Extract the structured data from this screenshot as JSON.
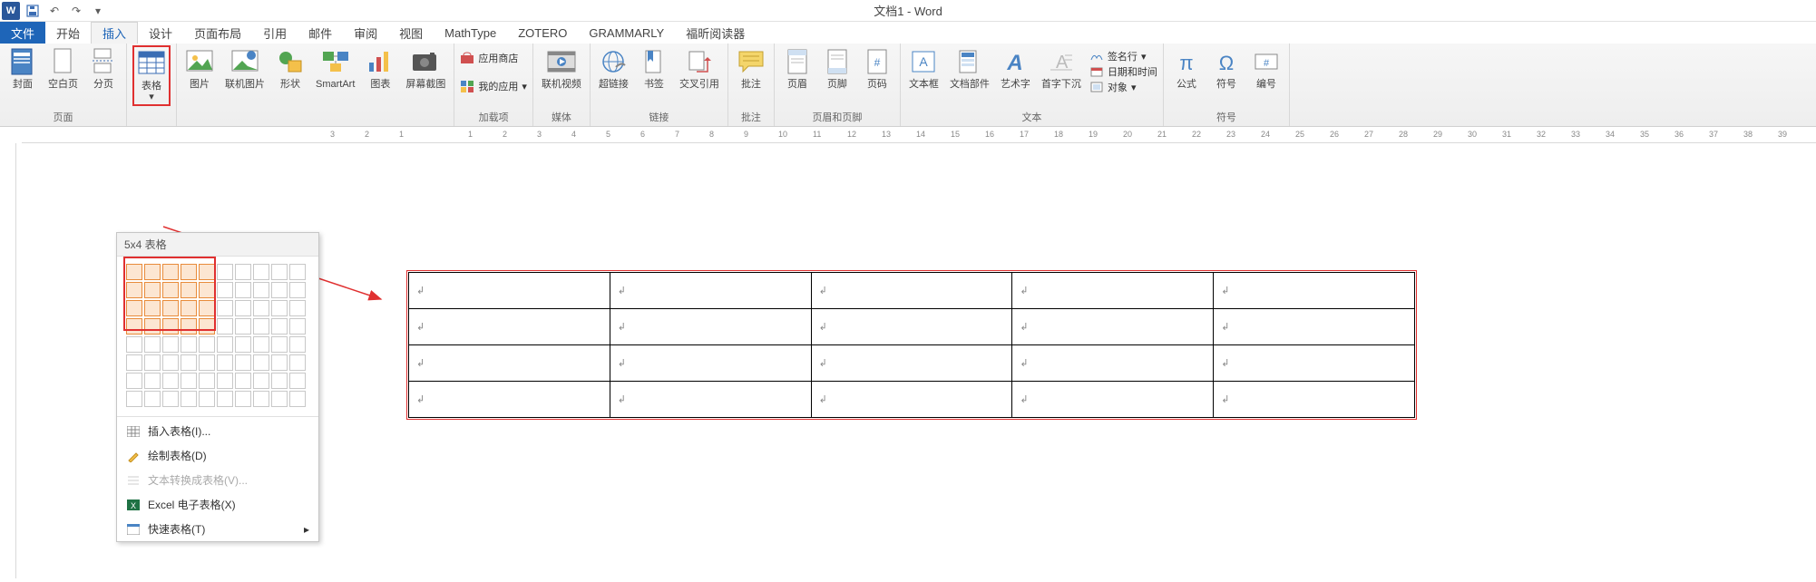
{
  "title": "文档1 - Word",
  "qat": {
    "undo_tip": "↶",
    "redo_tip": "↷"
  },
  "tabs": {
    "file": "文件",
    "list": [
      "开始",
      "插入",
      "设计",
      "页面布局",
      "引用",
      "邮件",
      "审阅",
      "视图",
      "MathType",
      "ZOTERO",
      "GRAMMARLY",
      "福昕阅读器"
    ],
    "active_index": 1
  },
  "ribbon": {
    "pages": {
      "label": "页面",
      "cover": "封面",
      "blank": "空白页",
      "break": "分页"
    },
    "table": {
      "label": "表格",
      "btn": "表格"
    },
    "illus": {
      "pic": "图片",
      "olpic": "联机图片",
      "shapes": "形状",
      "smartart": "SmartArt",
      "chart": "图表",
      "screenshot": "屏幕截图"
    },
    "addins": {
      "label": "加载项",
      "store": "应用商店",
      "myapps": "我的应用"
    },
    "media": {
      "label": "媒体",
      "video": "联机视频"
    },
    "links": {
      "label": "链接",
      "hyper": "超链接",
      "bookmark": "书签",
      "xref": "交叉引用"
    },
    "comments": {
      "label": "批注",
      "btn": "批注"
    },
    "hf": {
      "label": "页眉和页脚",
      "header": "页眉",
      "footer": "页脚",
      "pageno": "页码"
    },
    "text": {
      "label": "文本",
      "textbox": "文本框",
      "parts": "文档部件",
      "wordart": "艺术字",
      "dropcap": "首字下沉",
      "sig": "签名行",
      "datetime": "日期和时间",
      "obj": "对象"
    },
    "symbols": {
      "label": "符号",
      "eq": "公式",
      "sym": "符号",
      "num": "编号"
    }
  },
  "table_popup": {
    "header": "5x4 表格",
    "sel_cols": 5,
    "sel_rows": 4,
    "total_cols": 10,
    "total_rows": 8,
    "items": {
      "insert": "插入表格(I)...",
      "draw": "绘制表格(D)",
      "convert": "文本转换成表格(V)...",
      "excel": "Excel 电子表格(X)",
      "quick": "快速表格(T)"
    }
  },
  "document": {
    "table_rows": 4,
    "table_cols": 5,
    "cell_mark": "↲"
  },
  "ruler": {
    "h_nums": [
      "3",
      "2",
      "1",
      "",
      "1",
      "2",
      "3",
      "4",
      "5",
      "6",
      "7",
      "8",
      "9",
      "10",
      "11",
      "12",
      "13",
      "14",
      "15",
      "16",
      "17",
      "18",
      "19",
      "20",
      "21",
      "22",
      "23",
      "24",
      "25",
      "26",
      "27",
      "28",
      "29",
      "30",
      "31",
      "32",
      "33",
      "34",
      "35",
      "36",
      "37",
      "38",
      "39"
    ]
  }
}
